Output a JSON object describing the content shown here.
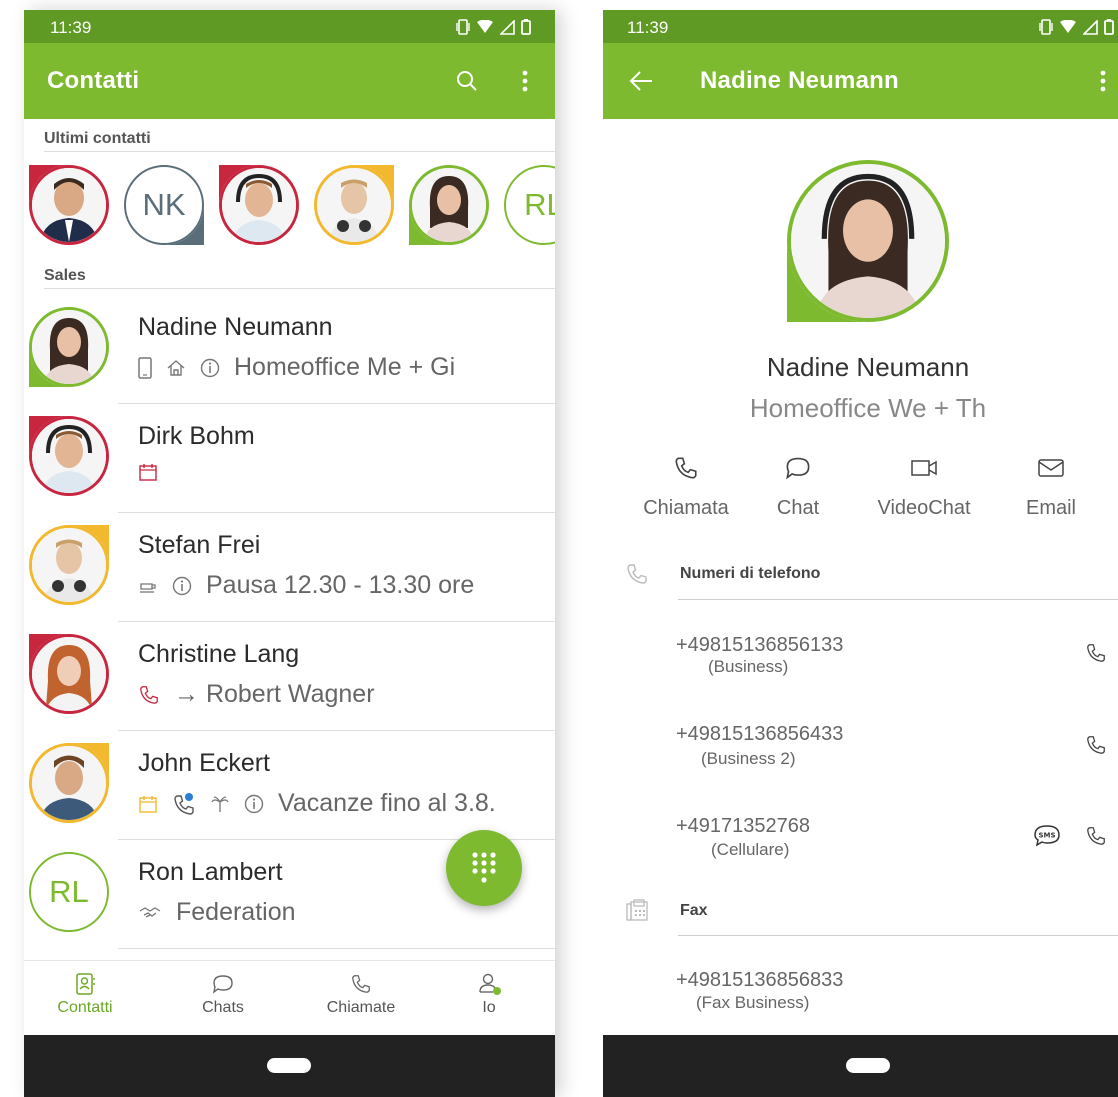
{
  "left": {
    "status_time": "11:39",
    "title": "Contatti",
    "recent_label": "Ultimi contatti",
    "recent": [
      {
        "type": "photo",
        "ring": "#c8253f",
        "corner": "#c8253f"
      },
      {
        "type": "initials",
        "initials": "NK",
        "ring": "#5a6e7a",
        "corner": "#5a6e7a"
      },
      {
        "type": "photo",
        "ring": "#c8253f",
        "corner": "#c8253f"
      },
      {
        "type": "photo",
        "ring": "#f2b82e",
        "corner": "#f2b82e"
      },
      {
        "type": "photo",
        "ring": "#7dba2f",
        "corner": "#7dba2f"
      },
      {
        "type": "initials",
        "initials": "RL",
        "ring": "#7dba2f",
        "corner": "#7dba2f"
      }
    ],
    "group_label": "Sales",
    "contacts": [
      {
        "name": "Nadine Neumann",
        "status": "Homeoffice Me + Gi",
        "ring": "#7dba2f",
        "icons": [
          "phone-device-icon",
          "home-icon",
          "info-icon"
        ]
      },
      {
        "name": "Dirk Bohm",
        "status": "",
        "ring": "#c8253f",
        "icons": [
          "calendar-icon"
        ]
      },
      {
        "name": "Stefan Frei",
        "status": "Pausa 12.30 - 13.30 ore",
        "ring": "#f2b82e",
        "icons": [
          "coffee-icon",
          "info-icon"
        ]
      },
      {
        "name": "Christine Lang",
        "status": "→ Robert Wagner",
        "ring": "#c8253f",
        "icons": [
          "phone-icon"
        ]
      },
      {
        "name": "John Eckert",
        "status": "Vacanze fino al 3.8.",
        "ring": "#f2b82e",
        "icons": [
          "calendar-icon",
          "call-forward-icon",
          "palm-icon",
          "info-icon"
        ]
      },
      {
        "name": "Ron Lambert",
        "status": "Federation",
        "ring": "#7dba2f",
        "initials": "RL",
        "icons": [
          "handshake-icon"
        ]
      }
    ],
    "nav": [
      {
        "label": "Contatti",
        "icon": "contacts-icon",
        "active": true
      },
      {
        "label": "Chats",
        "icon": "chat-icon",
        "active": false
      },
      {
        "label": "Chiamate",
        "icon": "phone-icon",
        "active": false
      },
      {
        "label": "Io",
        "icon": "user-icon",
        "active": false
      }
    ]
  },
  "right": {
    "status_time": "11:39",
    "title": "Nadine Neumann",
    "name": "Nadine Neumann",
    "status": "Homeoffice We + Th",
    "actions": [
      {
        "label": "Chiamata",
        "icon": "phone-icon"
      },
      {
        "label": "Chat",
        "icon": "chat-icon"
      },
      {
        "label": "VideoChat",
        "icon": "video-icon"
      },
      {
        "label": "Email",
        "icon": "mail-icon"
      }
    ],
    "phone_section": "Numeri di telefono",
    "numbers": [
      {
        "number": "+49815136856133",
        "type": "(Business)",
        "sms": false
      },
      {
        "number": "+49815136856433",
        "type": "(Business 2)",
        "sms": false
      },
      {
        "number": "+49171352768",
        "type": "(Cellulare)",
        "sms": true
      }
    ],
    "fax_section": "Fax",
    "fax": [
      {
        "number": "+49815136856833",
        "type": "(Fax Business)"
      }
    ]
  },
  "colors": {
    "appbar": "#7dba2f",
    "statusbar": "#5f9a24",
    "red": "#c8253f",
    "yellow": "#f2b82e",
    "green": "#7dba2f",
    "grey": "#5a6e7a"
  }
}
